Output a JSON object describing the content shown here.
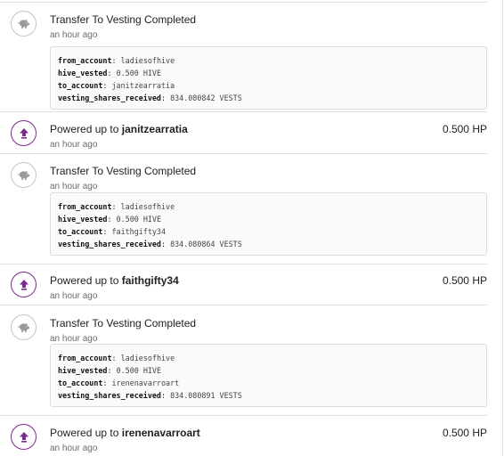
{
  "colors": {
    "accent": "#7e2b8f",
    "icon_grey": "#9a9a9a",
    "divider": "#e0e0e0"
  },
  "feed": {
    "items": [
      {
        "type": "transfer_to_vesting",
        "icon": "piggy-bank-icon",
        "title": "Transfer To Vesting Completed",
        "time": "an hour ago",
        "details": [
          {
            "key": "from_account",
            "value": "ladiesofhive"
          },
          {
            "key": "hive_vested",
            "value": "0.500 HIVE"
          },
          {
            "key": "to_account",
            "value": "janitzearratia"
          },
          {
            "key": "vesting_shares_received",
            "value": "834.080842 VESTS"
          }
        ]
      },
      {
        "type": "power_up",
        "icon": "power-up-arrow-icon",
        "title_prefix": "Powered up to",
        "account": "janitzearratia",
        "time": "an hour ago",
        "amount": "0.500 HP"
      },
      {
        "type": "transfer_to_vesting",
        "icon": "piggy-bank-icon",
        "title": "Transfer To Vesting Completed",
        "time": "an hour ago",
        "details": [
          {
            "key": "from_account",
            "value": "ladiesofhive"
          },
          {
            "key": "hive_vested",
            "value": "0.500 HIVE"
          },
          {
            "key": "to_account",
            "value": "faithgifty34"
          },
          {
            "key": "vesting_shares_received",
            "value": "834.080864 VESTS"
          }
        ]
      },
      {
        "type": "power_up",
        "icon": "power-up-arrow-icon",
        "title_prefix": "Powered up to",
        "account": "faithgifty34",
        "time": "an hour ago",
        "amount": "0.500 HP"
      },
      {
        "type": "transfer_to_vesting",
        "icon": "piggy-bank-icon",
        "title": "Transfer To Vesting Completed",
        "time": "an hour ago",
        "details": [
          {
            "key": "from_account",
            "value": "ladiesofhive"
          },
          {
            "key": "hive_vested",
            "value": "0.500 HIVE"
          },
          {
            "key": "to_account",
            "value": "irenenavarroart"
          },
          {
            "key": "vesting_shares_received",
            "value": "834.080891 VESTS"
          }
        ]
      },
      {
        "type": "power_up",
        "icon": "power-up-arrow-icon",
        "title_prefix": "Powered up to",
        "account": "irenenavarroart",
        "time": "an hour ago",
        "amount": "0.500 HP"
      }
    ]
  }
}
